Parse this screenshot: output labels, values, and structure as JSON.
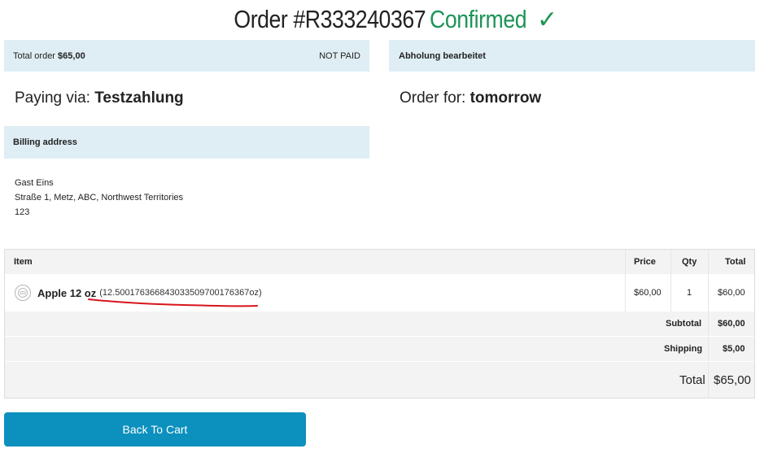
{
  "header": {
    "order_number": "Order #R333240367",
    "status": "Confirmed",
    "check": "✓"
  },
  "summary": {
    "total_label": "Total order",
    "total_value": "$65,00",
    "payment_status": "NOT PAID",
    "fulfillment_status": "Abholung bearbeitet"
  },
  "payment": {
    "label": "Paying via:",
    "method": "Testzahlung"
  },
  "delivery": {
    "label": "Order for:",
    "when": "tomorrow"
  },
  "billing": {
    "heading": "Billing address",
    "name": "Gast Eins",
    "street": "Straße 1, Metz, ABC, Northwest Territories",
    "zip": "123"
  },
  "table": {
    "headers": {
      "item": "Item",
      "price": "Price",
      "qty": "Qty",
      "total": "Total"
    },
    "items": [
      {
        "icon": "apple-product-icon",
        "name": "Apple 12 oz",
        "variant": "(12.500176366843033509700176367oz)",
        "price": "$60,00",
        "qty": "1",
        "total": "$60,00"
      }
    ],
    "subtotal_label": "Subtotal",
    "subtotal_value": "$60,00",
    "shipping_label": "Shipping",
    "shipping_value": "$5,00",
    "total_label": "Total",
    "total_value": "$65,00"
  },
  "actions": {
    "back_to_cart": "Back To Cart"
  },
  "colors": {
    "accent": "#0c90bd",
    "confirmed": "#1d9457",
    "panel": "#dfeef4",
    "annotation": "#d8141b"
  }
}
